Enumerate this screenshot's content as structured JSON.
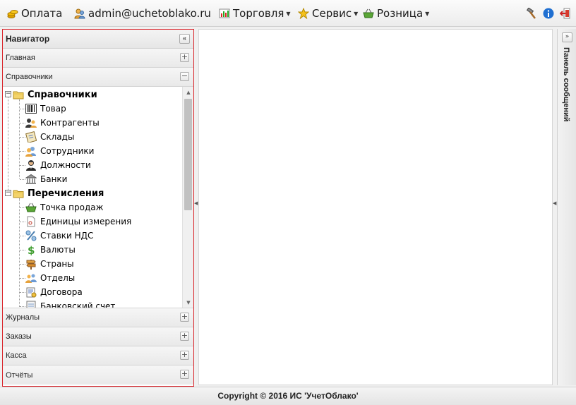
{
  "toolbar": {
    "payment_label": "Оплата",
    "user_label": "admin@uchetoblako.ru",
    "trade_label": "Торговля",
    "service_label": "Сервис",
    "retail_label": "Розница"
  },
  "navigator": {
    "title": "Навигатор",
    "sections_top": [
      {
        "label": "Главная",
        "state": "+"
      },
      {
        "label": "Справочники",
        "state": "−"
      }
    ],
    "tree": [
      {
        "label": "Справочники",
        "kind": "folder",
        "icon": "folder-icon"
      },
      {
        "label": "Товар",
        "kind": "leaf",
        "icon": "barcode-icon"
      },
      {
        "label": "Контрагенты",
        "kind": "leaf",
        "icon": "contacts-icon"
      },
      {
        "label": "Склады",
        "kind": "leaf",
        "icon": "clipboard-icon"
      },
      {
        "label": "Сотрудники",
        "kind": "leaf",
        "icon": "employees-icon"
      },
      {
        "label": "Должности",
        "kind": "leaf",
        "icon": "person-icon"
      },
      {
        "label": "Банки",
        "kind": "leaf",
        "icon": "bank-icon"
      },
      {
        "label": "Перечисления",
        "kind": "folder",
        "icon": "folder-icon"
      },
      {
        "label": "Точка продаж",
        "kind": "leaf",
        "icon": "basket-icon"
      },
      {
        "label": "Единицы измерения",
        "kind": "leaf",
        "icon": "document-icon"
      },
      {
        "label": "Ставки НДС",
        "kind": "leaf",
        "icon": "percent-icon"
      },
      {
        "label": "Валюты",
        "kind": "leaf",
        "icon": "dollar-icon"
      },
      {
        "label": "Страны",
        "kind": "leaf",
        "icon": "signpost-icon"
      },
      {
        "label": "Отделы",
        "kind": "leaf",
        "icon": "group-icon"
      },
      {
        "label": "Договора",
        "kind": "leaf",
        "icon": "contract-icon"
      },
      {
        "label": "Банковский счет",
        "kind": "leaf",
        "icon": "account-icon"
      }
    ],
    "sections_bottom": [
      {
        "label": "Журналы",
        "state": "+"
      },
      {
        "label": "Заказы",
        "state": "+"
      },
      {
        "label": "Касса",
        "state": "+"
      },
      {
        "label": "Отчёты",
        "state": "+"
      }
    ]
  },
  "right_panel": {
    "title": "Панель сообщений"
  },
  "footer": {
    "text": "Copyright © 2016 ИС 'УчетОблако'"
  },
  "colors": {
    "nav_border": "#d9242a",
    "info": "#1f6fd1"
  }
}
